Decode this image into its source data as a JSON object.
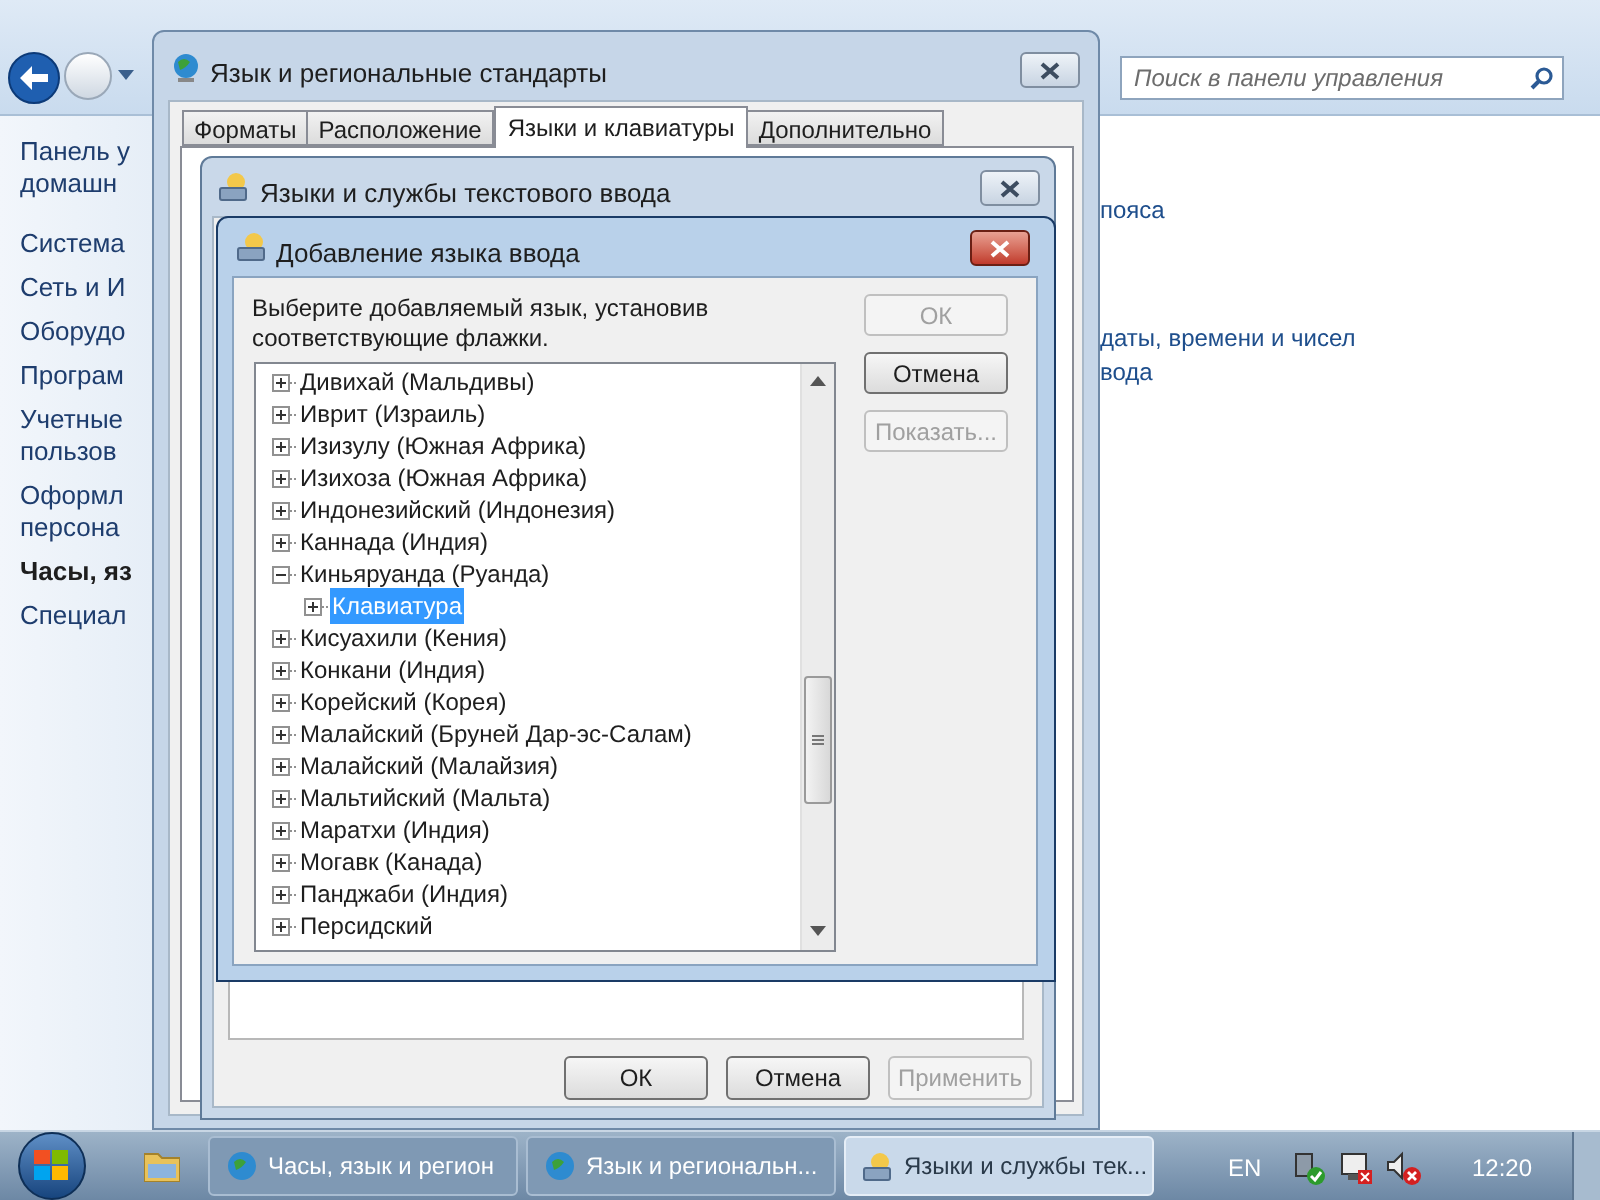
{
  "control_panel": {
    "search": {
      "placeholder": "Поиск в панели управления"
    },
    "sidebar": {
      "items": [
        {
          "label": "Панель у\nдомашн",
          "selected": false
        },
        {
          "label": "Система",
          "selected": false
        },
        {
          "label": "Сеть и И",
          "selected": false
        },
        {
          "label": "Оборудо",
          "selected": false
        },
        {
          "label": "Програм",
          "selected": false
        },
        {
          "label": "Учетные\nпользов",
          "selected": false
        },
        {
          "label": "Оформл\nперсона",
          "selected": false
        },
        {
          "label": "Часы, яз",
          "selected": true
        },
        {
          "label": "Специал",
          "selected": false
        }
      ]
    },
    "links": [
      "пояса",
      "даты, времени и чисел",
      "вода"
    ]
  },
  "regional_dialog": {
    "title": "Язык и региональные стандарты",
    "tabs": [
      {
        "label": "Форматы",
        "selected": false
      },
      {
        "label": "Расположение",
        "selected": false
      },
      {
        "label": "Языки и клавиатуры",
        "selected": true
      },
      {
        "label": "Дополнительно",
        "selected": false
      }
    ]
  },
  "services_dialog": {
    "title": "Языки и службы текстового ввода",
    "buttons": [
      {
        "label": "ОК",
        "disabled": false
      },
      {
        "label": "Отмена",
        "disabled": false
      },
      {
        "label": "Применить",
        "disabled": true
      }
    ]
  },
  "add_dialog": {
    "title": "Добавление языка ввода",
    "instruction": "Выберите добавляемый язык, установив соответствующие флажки.",
    "buttons": [
      {
        "label": "ОК",
        "disabled": true
      },
      {
        "label": "Отмена",
        "disabled": false
      },
      {
        "label": "Показать...",
        "disabled": true
      }
    ],
    "tree": [
      {
        "label": "Дивихай (Мальдивы)",
        "expanded": false,
        "selected": false
      },
      {
        "label": "Иврит (Израиль)",
        "expanded": false,
        "selected": false
      },
      {
        "label": "Изизулу (Южная Африка)",
        "expanded": false,
        "selected": false
      },
      {
        "label": "Изихоза (Южная Африка)",
        "expanded": false,
        "selected": false
      },
      {
        "label": "Индонезийский (Индонезия)",
        "expanded": false,
        "selected": false
      },
      {
        "label": "Каннада (Индия)",
        "expanded": false,
        "selected": false
      },
      {
        "label": "Киньяруанда (Руанда)",
        "expanded": true,
        "selected": false,
        "children": [
          {
            "label": "Клавиатура",
            "expanded": false,
            "selected": true
          }
        ]
      },
      {
        "label": "Кисуахили (Кения)",
        "expanded": false,
        "selected": false
      },
      {
        "label": "Конкани (Индия)",
        "expanded": false,
        "selected": false
      },
      {
        "label": "Корейский (Корея)",
        "expanded": false,
        "selected": false
      },
      {
        "label": "Малайский (Бруней Дар-эс-Салам)",
        "expanded": false,
        "selected": false
      },
      {
        "label": "Малайский (Малайзия)",
        "expanded": false,
        "selected": false
      },
      {
        "label": "Мальтийский (Мальта)",
        "expanded": false,
        "selected": false
      },
      {
        "label": "Маратхи (Индия)",
        "expanded": false,
        "selected": false
      },
      {
        "label": "Могавк (Канада)",
        "expanded": false,
        "selected": false
      },
      {
        "label": "Панджаби (Индия)",
        "expanded": false,
        "selected": false
      },
      {
        "label": "Персидский",
        "expanded": false,
        "selected": false
      }
    ]
  },
  "taskbar": {
    "tasks": [
      {
        "label": "Часы, язык и регион",
        "selected": false
      },
      {
        "label": "Язык и региональн...",
        "selected": false
      },
      {
        "label": "Языки и службы тек...",
        "selected": true
      }
    ],
    "language": "EN",
    "clock": "12:20"
  }
}
